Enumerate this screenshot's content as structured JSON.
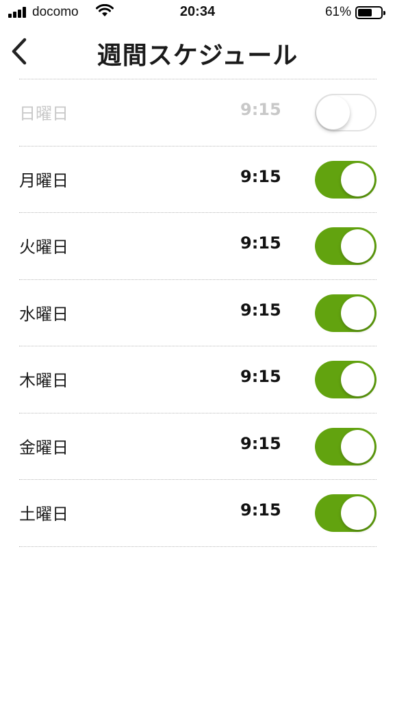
{
  "status_bar": {
    "carrier": "docomo",
    "time": "20:34",
    "battery_percent": "61%",
    "battery_level": 0.61
  },
  "header": {
    "title": "週間スケジュール",
    "back_icon": "chevron-left-icon"
  },
  "days": [
    {
      "label": "日曜日",
      "time": "9:15",
      "enabled": false
    },
    {
      "label": "月曜日",
      "time": "9:15",
      "enabled": true
    },
    {
      "label": "火曜日",
      "time": "9:15",
      "enabled": true
    },
    {
      "label": "水曜日",
      "time": "9:15",
      "enabled": true
    },
    {
      "label": "木曜日",
      "time": "9:15",
      "enabled": true
    },
    {
      "label": "金曜日",
      "time": "9:15",
      "enabled": true
    },
    {
      "label": "土曜日",
      "time": "9:15",
      "enabled": true
    }
  ],
  "colors": {
    "toggle_on": "#62a30f",
    "disabled_text": "#c8c8c8"
  }
}
